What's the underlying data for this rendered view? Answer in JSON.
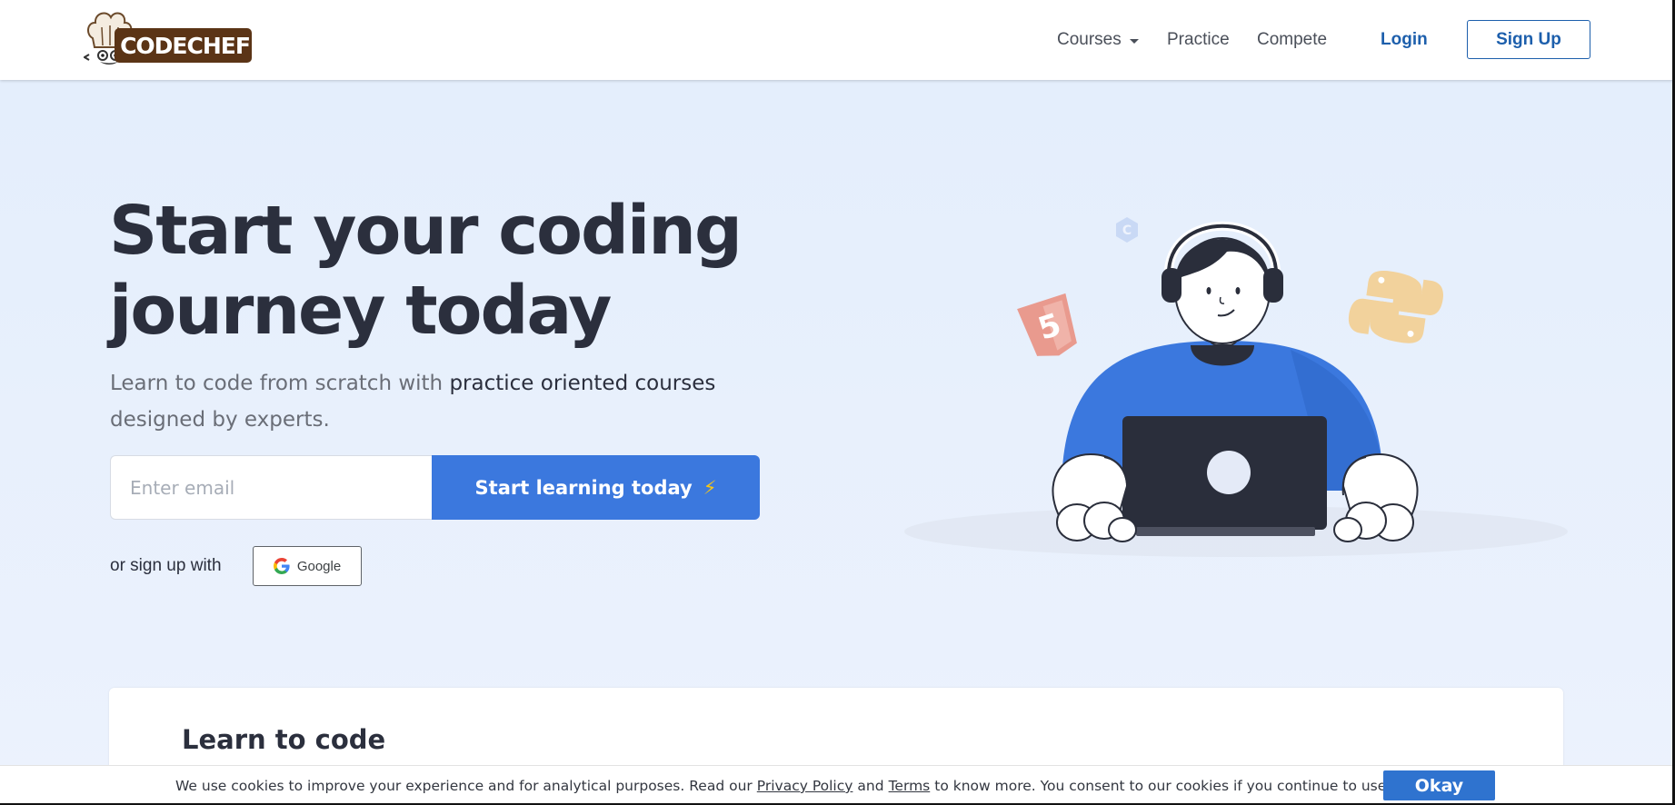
{
  "brand": {
    "logo_text": "CODECHEF",
    "accent": "#3b78de",
    "link_color": "#1d5fac",
    "logo_bg": "#5b3416"
  },
  "nav": {
    "courses": "Courses",
    "practice": "Practice",
    "compete": "Compete",
    "login": "Login",
    "signup": "Sign Up"
  },
  "hero": {
    "title_line1": "Start your coding",
    "title_line2": "journey today",
    "subtitle_plain": "Learn to code from scratch with",
    "subtitle_strong": "practice oriented courses",
    "subtitle_end": "designed by experts.",
    "email_placeholder": "Enter email",
    "cta_label": "Start learning today",
    "cta_icon": "lightning-icon",
    "or_signup": "or sign up with",
    "google_label": "Google"
  },
  "learn": {
    "title": "Learn to code"
  },
  "cookie": {
    "text_before": "We use cookies to improve your experience and for analytical purposes. Read our",
    "privacy_link": "Privacy Policy",
    "and": "and",
    "terms_link": "Terms",
    "text_after": "to know more. You consent to our cookies if you continue to use our website.",
    "okay": "Okay"
  }
}
